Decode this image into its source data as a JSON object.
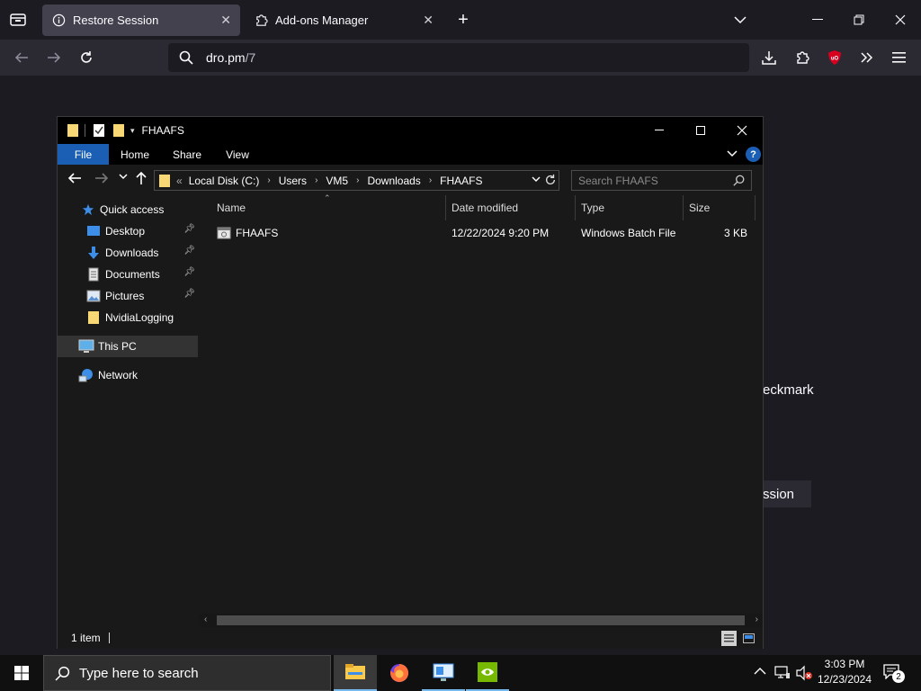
{
  "browser": {
    "tabs": [
      {
        "label": "Restore Session",
        "icon": "info-icon",
        "active": true
      },
      {
        "label": "Add-ons Manager",
        "icon": "puzzle-icon",
        "active": false
      }
    ],
    "url": "dro.pm/7",
    "url_host": "dro.pm",
    "url_path": "/7"
  },
  "page": {
    "background_text": "eckmark",
    "background_button": "ssion"
  },
  "explorer": {
    "title": "FHAAFS",
    "ribbon_tabs": [
      "File",
      "Home",
      "Share",
      "View"
    ],
    "breadcrumb": [
      "Local Disk (C:)",
      "Users",
      "VM5",
      "Downloads",
      "FHAAFS"
    ],
    "breadcrumb_prefix": "«",
    "search_placeholder": "Search FHAAFS",
    "nav": {
      "quick_access": "Quick access",
      "quick_items": [
        {
          "label": "Desktop",
          "icon": "desktop-folder-icon",
          "pinned": true
        },
        {
          "label": "Downloads",
          "icon": "download-arrow-icon",
          "pinned": true
        },
        {
          "label": "Documents",
          "icon": "documents-icon",
          "pinned": true
        },
        {
          "label": "Pictures",
          "icon": "pictures-icon",
          "pinned": true
        },
        {
          "label": "NvidiaLogging",
          "icon": "folder-icon",
          "pinned": false
        }
      ],
      "this_pc": "This PC",
      "network": "Network"
    },
    "columns": [
      "Name",
      "Date modified",
      "Type",
      "Size"
    ],
    "files": [
      {
        "name": "FHAAFS",
        "date": "12/22/2024 9:20 PM",
        "type": "Windows Batch File",
        "size": "3 KB"
      }
    ],
    "status": "1 item"
  },
  "taskbar": {
    "search_placeholder": "Type here to search",
    "time": "3:03 PM",
    "date": "12/23/2024",
    "notification_count": "2"
  },
  "colors": {
    "accent": "#1a5fb4",
    "folder": "#f8d775",
    "browser_bg": "#1c1b22",
    "ublock": "#d8001f"
  }
}
